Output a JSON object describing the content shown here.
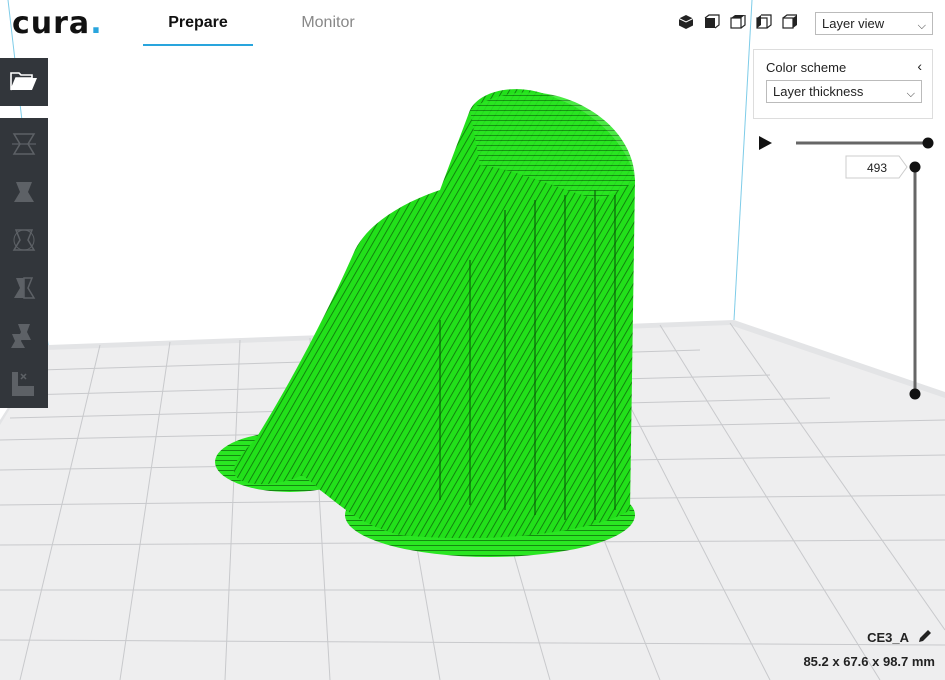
{
  "app": {
    "logo": "cura",
    "accent_color": "#29a5dd",
    "model_color": "#22e01a"
  },
  "header": {
    "tabs": [
      {
        "label": "Prepare",
        "active": true
      },
      {
        "label": "Monitor",
        "active": false
      }
    ],
    "view_icons": [
      "3d-view-icon",
      "front-view-icon",
      "top-view-icon",
      "left-view-icon",
      "right-view-icon"
    ],
    "view_mode": {
      "selected": "Layer view"
    }
  },
  "sidebar": {
    "open_icon": "folder-open-icon",
    "tools": [
      "move-tool-icon",
      "scale-tool-icon",
      "rotate-tool-icon",
      "mirror-tool-icon",
      "per-model-settings-icon",
      "support-blocker-icon"
    ]
  },
  "color_panel": {
    "title": "Color scheme",
    "scheme": {
      "selected": "Layer thickness"
    }
  },
  "layer_slider": {
    "current_layer": "493",
    "play_icon": "play-icon"
  },
  "model_info": {
    "name": "CE3_A",
    "dimensions": "85.2 x 67.6 x 98.7 mm",
    "edit_icon": "pencil-icon"
  }
}
